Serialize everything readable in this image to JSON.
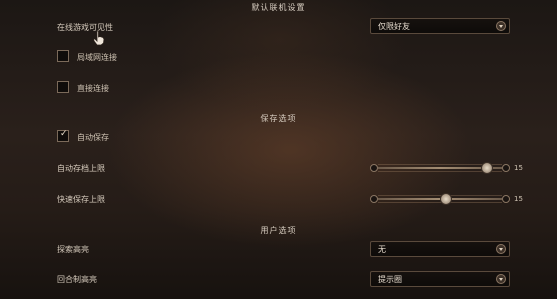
{
  "header": {
    "title": "默认联机设置"
  },
  "online": {
    "visibility_label": "在线游戏可见性",
    "visibility_value": "仅限好友",
    "lan_label": "局域网连接",
    "lan_checked": false,
    "direct_label": "直接连接",
    "direct_checked": false
  },
  "save": {
    "section_title": "保存选项",
    "autosave_label": "自动保存",
    "autosave_checked": true,
    "autosave_limit_label": "自动存档上限",
    "autosave_limit_value": "15",
    "autosave_limit_fraction": 0.88,
    "quicksave_limit_label": "快速保存上限",
    "quicksave_limit_value": "15",
    "quicksave_limit_fraction": 0.55
  },
  "user": {
    "section_title": "用户选项",
    "explore_highlight_label": "探索高亮",
    "explore_highlight_value": "无",
    "turn_highlight_label": "回合制高亮",
    "turn_highlight_value": "提示圈"
  },
  "colors": {
    "accent": "#cfc3b3",
    "panel": "#0e0b09"
  }
}
